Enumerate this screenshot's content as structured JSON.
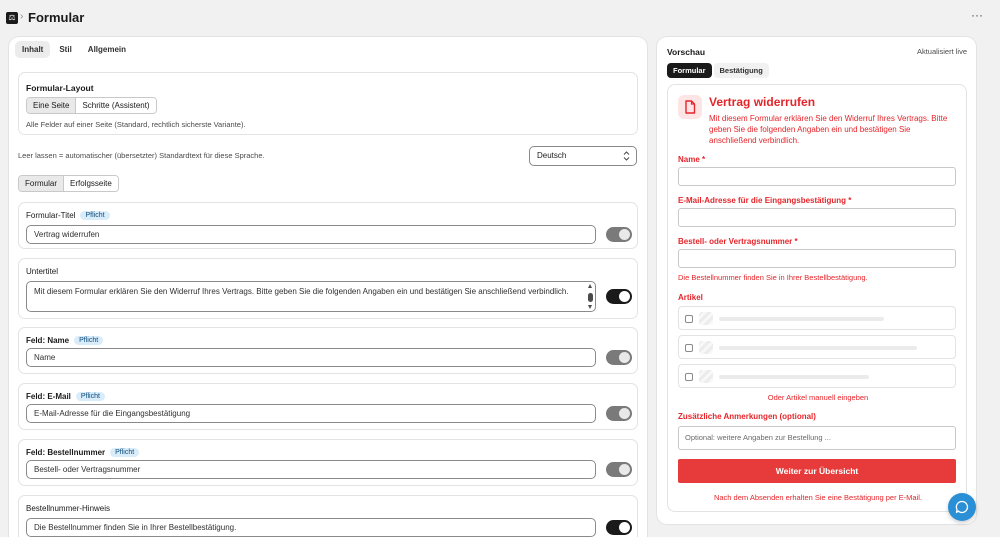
{
  "header": {
    "app_icon_glyph": "⚖",
    "separator": "›",
    "title": "Formular",
    "more_glyph": "···"
  },
  "editor": {
    "tabs": [
      {
        "label": "Inhalt",
        "active": true
      },
      {
        "label": "Stil",
        "active": false
      },
      {
        "label": "Allgemein",
        "active": false
      }
    ],
    "layout": {
      "title": "Formular-Layout",
      "options": [
        "Eine Seite",
        "Schritte (Assistent)"
      ],
      "selected": "Eine Seite",
      "hint": "Alle Felder auf einer Seite (Standard, rechtlich sicherste Variante)."
    },
    "language_hint": "Leer lassen = automatischer (übersetzter) Standardtext für diese Sprache.",
    "language": {
      "selected": "Deutsch",
      "chevron": "⌃⌄"
    },
    "subtabs": [
      "Formular",
      "Erfolgsseite"
    ],
    "subtab_selected": "Formular",
    "fields": [
      {
        "label": "Formular-Titel",
        "badge": "Pflicht",
        "value": "Vertrag widerrufen",
        "toggle_on": false
      },
      {
        "label": "Untertitel",
        "badge": "",
        "value": "Mit diesem Formular erklären Sie den Widerruf Ihres Vertrags. Bitte geben Sie die folgenden Angaben ein und bestätigen Sie anschließend verbindlich.",
        "toggle_on": true
      },
      {
        "label": "Feld: Name",
        "badge": "Pflicht",
        "value": "Name",
        "toggle_on": false
      },
      {
        "label": "Feld: E-Mail",
        "badge": "Pflicht",
        "value": "E-Mail-Adresse für die Eingangsbestätigung",
        "toggle_on": false
      },
      {
        "label": "Feld: Bestellnummer",
        "badge": "Pflicht",
        "value": "Bestell- oder Vertragsnummer",
        "toggle_on": false
      },
      {
        "label": "Bestellnummer-Hinweis",
        "badge": "",
        "value": "Die Bestellnummer finden Sie in Ihrer Bestellbestätigung.",
        "toggle_on": true
      }
    ]
  },
  "preview": {
    "title": "Vorschau",
    "live_label": "Aktualisiert live",
    "tabs": [
      "Formular",
      "Bestätigung"
    ],
    "tab_selected": "Formular",
    "form": {
      "title": "Vertrag widerrufen",
      "description": "Mit diesem Formular erklären Sie den Widerruf Ihres Vertrags. Bitte geben Sie die folgenden Angaben ein und bestätigen Sie anschließend verbindlich.",
      "name_label": "Name *",
      "email_label": "E-Mail-Adresse für die Eingangsbestätigung *",
      "order_label": "Bestell- oder Vertragsnummer *",
      "order_hint": "Die Bestellnummer finden Sie in Ihrer Bestellbestätigung.",
      "articles_label": "Artikel",
      "article_rows": 3,
      "manual_link": "Oder Artikel manuell eingeben",
      "notes_label": "Zusätzliche Anmerkungen (optional)",
      "notes_placeholder": "Optional: weitere Angaben zur Bestellung ...",
      "submit_label": "Weiter zur Übersicht",
      "after_note": "Nach dem Absenden erhalten Sie eine Bestätigung per E-Mail."
    }
  },
  "colors": {
    "accent_red": "#e5252a",
    "button_red": "#e73a3a",
    "chat_blue": "#2b8fd6",
    "dark": "#1a1a1a"
  },
  "icons": {
    "doc": "document-icon",
    "chat": "chat-bubble-icon"
  }
}
